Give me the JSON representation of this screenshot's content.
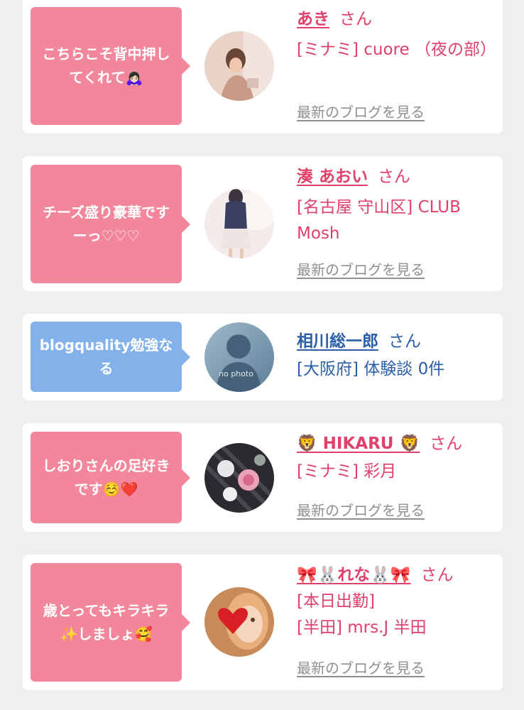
{
  "entries": [
    {
      "comment": "こちらこそ背中押してくれて🙇🏻‍♀️",
      "name": "あき",
      "honorific": "さん",
      "lines": [
        "[ミナミ] cuore （夜の部）"
      ],
      "blog_link": "最新のブログを見る",
      "theme": "pink"
    },
    {
      "comment": "チーズ盛り豪華ですーっ♡♡♡",
      "name": "湊 あおい",
      "honorific": "さん",
      "lines": [
        "[名古屋 守山区] CLUB Mosh"
      ],
      "blog_link": "最新のブログを見る",
      "theme": "pink"
    },
    {
      "comment": "blogquality勉強なる",
      "name": "相川総一郎",
      "honorific": "さん",
      "lines": [
        "[大阪府] 体験談 0件"
      ],
      "avatar_text": "no photo",
      "theme": "blue"
    },
    {
      "comment": "しおりさんの足好きです☺️❤️",
      "name": "🦁 HIKARU 🦁",
      "honorific": "さん",
      "lines": [
        "[ミナミ] 彩月"
      ],
      "blog_link": "最新のブログを見る",
      "theme": "pink"
    },
    {
      "comment": "歳とってもキラキラ✨しましょ🥰",
      "name": "🎀🐰れな🐰🎀",
      "honorific": "さん",
      "lines": [
        "[本日出勤]",
        "[半田] mrs.J 半田"
      ],
      "blog_link": "最新のブログを見る",
      "theme": "pink"
    }
  ],
  "colors": {
    "pink_bubble": "#f2879b",
    "blue_bubble": "#83b1ea",
    "pink_text": "#e0406a",
    "blue_text": "#2a5fa8",
    "link_gray": "#8f8f8f"
  }
}
